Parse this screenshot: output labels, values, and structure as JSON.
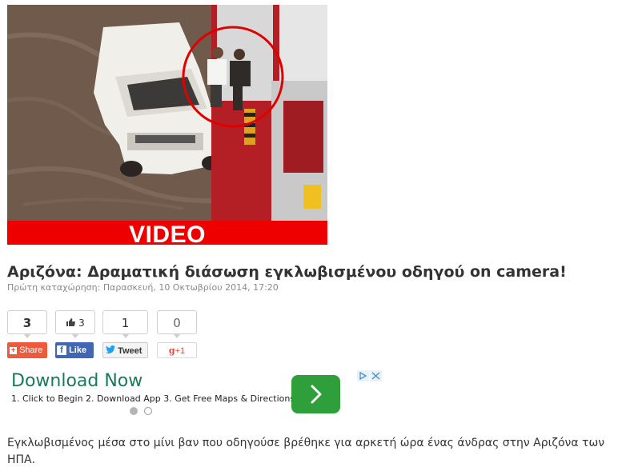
{
  "hero": {
    "badge": "VIDEO"
  },
  "article": {
    "title": "Αριζόνα: Δραματική διάσωση εγκλωβισμένου οδηγού on camera!",
    "meta": "Πρώτη καταχώρηση: Παρασκευή, 10 Οκτωβρίου 2014, 17:20",
    "body": "Εγκλωβισμένος μέσα στο μίνι βαν που οδηγούσε βρέθηκε για αρκετή ώρα ένας άνδρας στην Αριζόνα των ΗΠΑ."
  },
  "share": {
    "total": {
      "count": "3",
      "label": "Share"
    },
    "facebook": {
      "count": "3",
      "label": "Like"
    },
    "twitter": {
      "count": "1",
      "label": "Tweet"
    },
    "gplus": {
      "count": "0",
      "label": "+1"
    }
  },
  "ad": {
    "title": "Download Now",
    "text": "1. Click to Begin 2. Download App 3. Get Free Maps & Directions",
    "carousel": {
      "slides": 2,
      "active": 1
    }
  },
  "colors": {
    "video_bar": "#ee0000",
    "ad_button": "#2e9f3a",
    "facebook": "#4267b2",
    "share": "#f05a3c",
    "gplus": "#dd4b39",
    "ad_title": "#1a7a5c"
  }
}
